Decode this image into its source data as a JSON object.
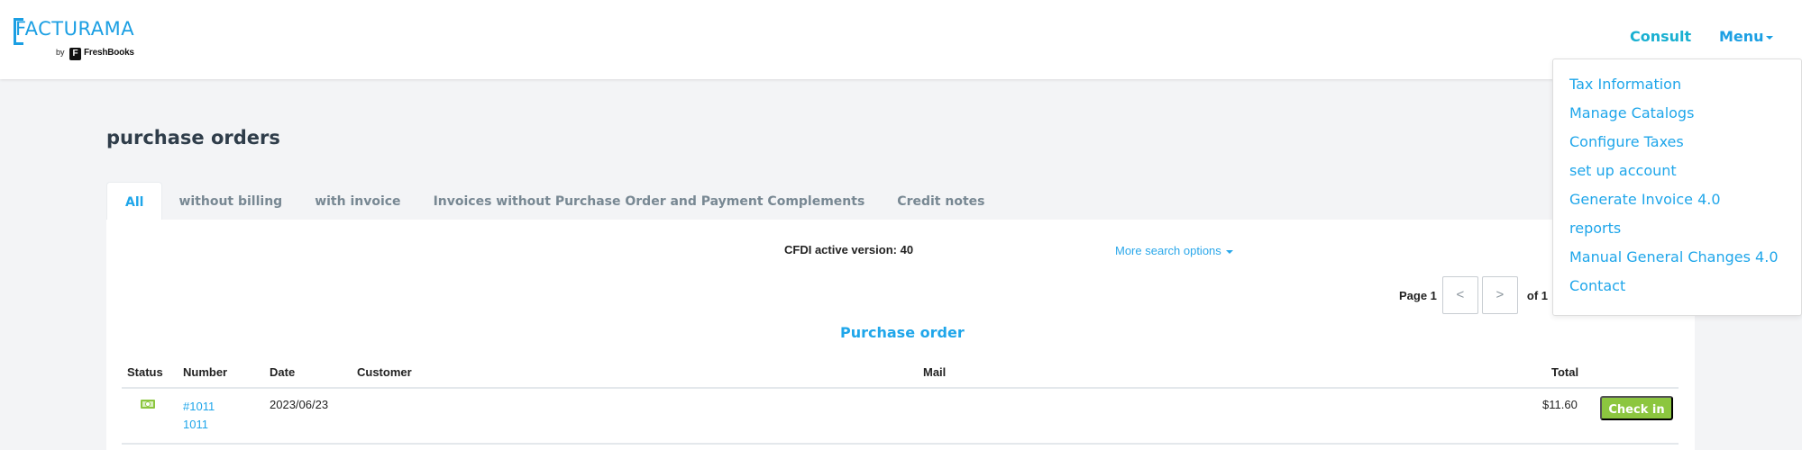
{
  "header": {
    "logo": {
      "brand": "FACTURAMA",
      "by": "by",
      "partner_icon": "F",
      "partner": "FreshBooks"
    },
    "nav": {
      "consult": "Consult",
      "menu": "Menu"
    }
  },
  "menu_dropdown": {
    "items": [
      "Tax Information",
      "Manage Catalogs",
      "Configure Taxes",
      "set up account",
      "Generate Invoice 4.0",
      "reports",
      "Manual General Changes 4.0",
      "Contact"
    ]
  },
  "page": {
    "title": "purchase orders"
  },
  "tabs": [
    {
      "label": "All",
      "active": true
    },
    {
      "label": "without billing",
      "active": false
    },
    {
      "label": "with invoice",
      "active": false
    },
    {
      "label": "Invoices without Purchase Order and Payment Complements",
      "active": false
    },
    {
      "label": "Credit notes",
      "active": false
    }
  ],
  "filters": {
    "cfdi_version": "CFDI active version: 40",
    "more_search": "More search options"
  },
  "pagination": {
    "page_label": "Page 1",
    "prev": "<",
    "next": ">",
    "of_label": "of 1"
  },
  "section_title": "Purchase order",
  "table": {
    "columns": [
      "Status",
      "Number",
      "Date",
      "Customer",
      "Mail",
      "Total"
    ],
    "rows": [
      {
        "status_icon": "money-bill-icon",
        "number_line1": "#1011",
        "number_line2": "1011",
        "date": "2023/06/23",
        "customer": "",
        "mail": "",
        "total": "$11.60",
        "action": "Check in"
      }
    ]
  },
  "colors": {
    "brand": "#1b9fe3",
    "link": "#1fa6ea",
    "success": "#8cc63f",
    "title": "#2f3d4a",
    "tab_inactive": "#788893",
    "background": "#f3f4f6"
  }
}
